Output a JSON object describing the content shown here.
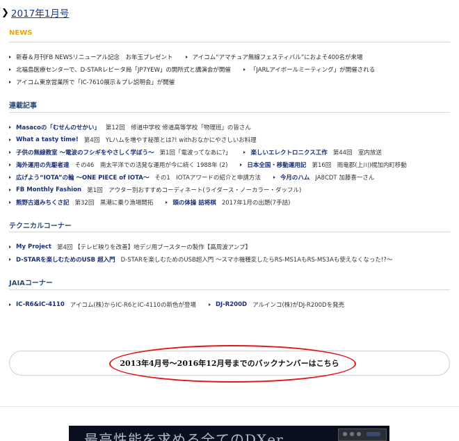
{
  "issue": {
    "title": "2017年1月号"
  },
  "sections": {
    "news": {
      "heading": "NEWS",
      "rows": [
        [
          {
            "title": "新春＆月刊FB NEWSリニューアル記念　お年玉プレゼント"
          },
          {
            "title": "アイコム“アマチュア無線フェスティバル”におよそ400名が来場"
          }
        ],
        [
          {
            "title": "北福島医療センターで、D-STARレピータ局「JP7YEW」の開所式と講演会が開催"
          },
          {
            "title": "「JARLアイボールミーティング」が開催される"
          }
        ],
        [
          {
            "title": "アイコム東京営業所で「IC-7610展示＆プレ説明会」が開催"
          }
        ]
      ]
    },
    "serial": {
      "heading": "連載記事",
      "rows": [
        [
          {
            "title": "Masacoの「むせんのせかい」",
            "desc": "第12回　修道中学校 修道高等学校「物理班」の皆さん"
          }
        ],
        [
          {
            "title": "What a tasty time!",
            "desc": "第4回　YLハムを増やす秘策とは?! withおなかにやさしいお料理"
          }
        ],
        [
          {
            "title": "子供の無線教室 〜電波のフシギをやさしく学ぼう〜",
            "desc": "第1回「電波ってなあに?」"
          },
          {
            "title": "楽しいエレクトロニクス工作",
            "desc": "第44回　室内放送"
          }
        ],
        [
          {
            "title": "海外運用の先駆者達",
            "desc": "その46　南太平洋での活発な運用が今に続く 1988年 (2)"
          },
          {
            "title": "日本全国・移動運用記",
            "desc": "第16回　雨竜郡(上川)幌加内町移動"
          }
        ],
        [
          {
            "title": "広げよう“IOTA”の輪 〜ONE PIECE of IOTA〜",
            "desc": "その1　IOTAアワードの紹介と申請方法"
          },
          {
            "title": "今月のハム",
            "desc": "JA8CDT 加藤喜一さん"
          }
        ],
        [
          {
            "title": "FB Monthly Fashion",
            "desc": "第1回　アウター別おすすめコーディネート(ライダース・ノーカラー・ダッフル)"
          }
        ],
        [
          {
            "title": "熊野古道みちくさ記",
            "desc": "第32回　黒潮に乗り漁場開拓"
          },
          {
            "title": "頭の体操 詰将棋",
            "desc": "2017年1月の出題(7手詰)"
          }
        ]
      ]
    },
    "technical": {
      "heading": "テクニカルコーナー",
      "rows": [
        [
          {
            "title": "My Project",
            "desc": "第4回 【テレビ映りを改善】地デジ用ブースターの製作【高周波アンプ】"
          }
        ],
        [
          {
            "title": "D-STARを楽しむためのUSB 超入門",
            "desc": "D-STARを楽しむためのUSB超入門 〜スマホ機種変したらRS-MS1AもRS-MS3Aも使えなくなった!?〜"
          }
        ]
      ]
    },
    "jaia": {
      "heading": "JAIAコーナー",
      "rows": [
        [
          {
            "title": "IC-R6&IC-4110",
            "desc": "アイコム(株)からIC-R6とIC-4110の新色が登場"
          },
          {
            "title": "DJ-R200D",
            "desc": "アルインコ(株)がDJ-R200Dを発売"
          }
        ]
      ]
    }
  },
  "backnumber": {
    "label": "2013年4月号〜2016年12月号までのバックナンバーはこちら"
  },
  "banner": {
    "text": "最高性能を求める全てのDXer"
  }
}
